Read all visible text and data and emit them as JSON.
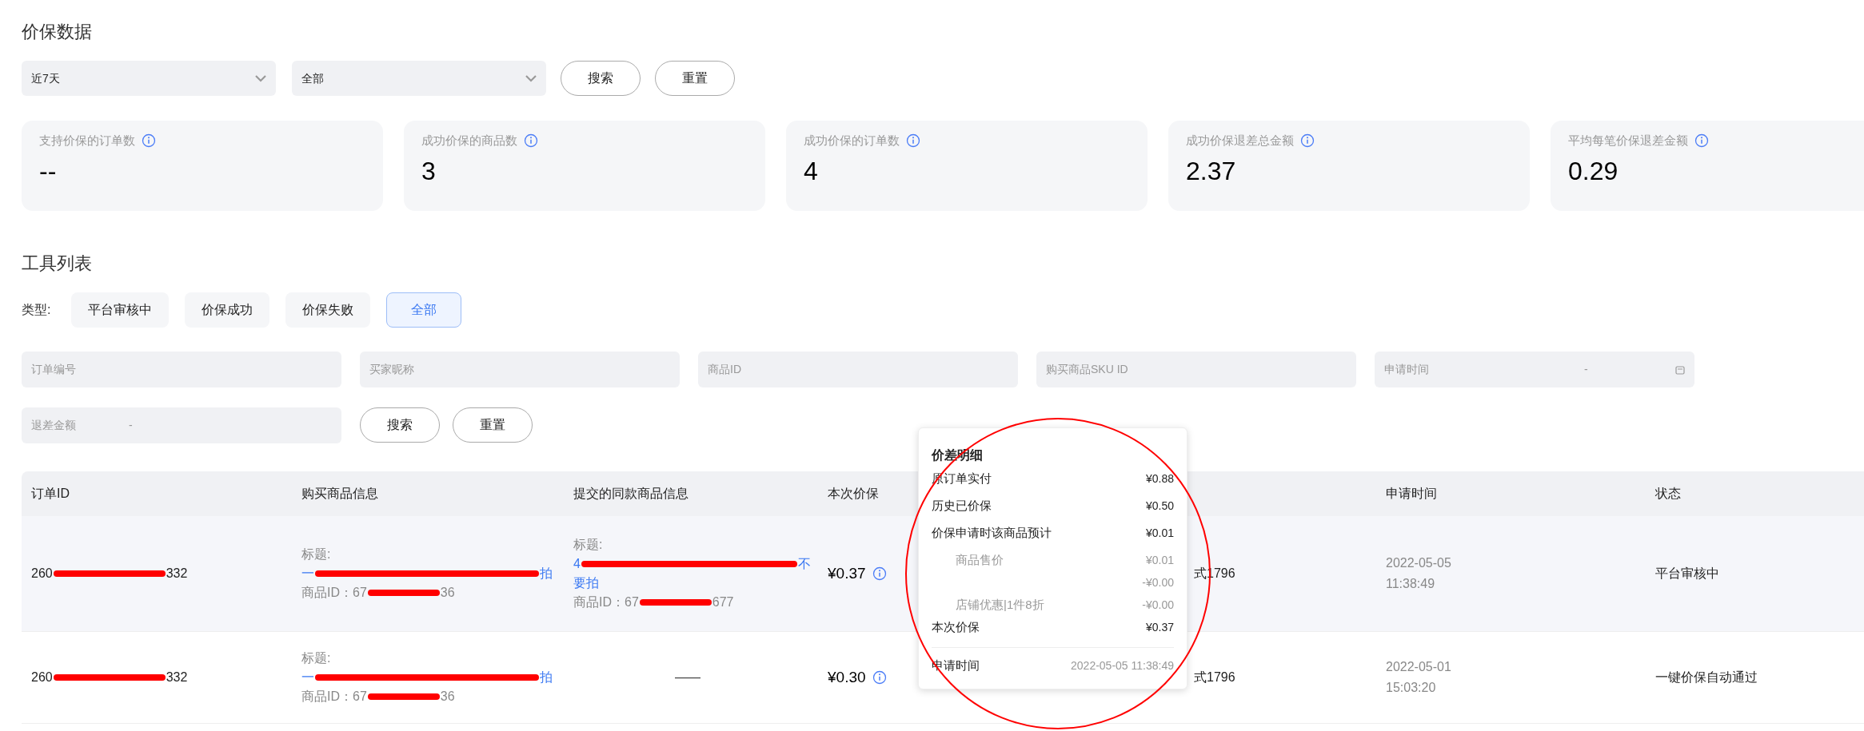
{
  "section_title": "价保数据",
  "filters": [
    {
      "kind": "select",
      "value": "近7天"
    },
    {
      "kind": "select",
      "value": "全部"
    }
  ],
  "filter_buttons": [
    "搜索",
    "重置"
  ],
  "stats": [
    {
      "label": "支持价保的订单数",
      "value": "--"
    },
    {
      "label": "成功价保的商品数",
      "value": "3"
    },
    {
      "label": "成功价保的订单数",
      "value": "4"
    },
    {
      "label": "成功价保退差总金额",
      "value": "2.37"
    },
    {
      "label": "平均每笔价保退差金额",
      "value": "0.29"
    }
  ],
  "list_title": "工具列表",
  "type_label": "类型:",
  "type_tabs": [
    {
      "label": "平台审核中",
      "selected": false
    },
    {
      "label": "价保成功",
      "selected": false
    },
    {
      "label": "价保失败",
      "selected": false
    },
    {
      "label": "全部",
      "selected": true
    }
  ],
  "search_fields": [
    {
      "kind": "text",
      "placeholder": "订单编号"
    },
    {
      "kind": "text",
      "placeholder": "买家昵称"
    },
    {
      "kind": "text",
      "placeholder": "商品ID"
    },
    {
      "kind": "text",
      "placeholder": "购买商品SKU ID"
    },
    {
      "kind": "date_range",
      "placeholder": "申请时间",
      "separator": "-"
    },
    {
      "kind": "range",
      "placeholder": "退差金额",
      "separator": "-"
    }
  ],
  "search_buttons": [
    "搜索",
    "重置"
  ],
  "table": {
    "columns": [
      "订单ID",
      "购买商品信息",
      "提交的同款商品信息",
      "本次价保",
      "",
      "申请时间",
      "状态"
    ],
    "rows": [
      {
        "order_id_start": "260",
        "order_id_end": "332",
        "bought": {
          "label": "标题:",
          "title_start": "一",
          "title_end": "拍",
          "id_start": "商品ID：67",
          "id_end": "36"
        },
        "submitted": {
          "label": "标题:",
          "title_start": "4",
          "title_end": "不",
          "title_line2": "要拍",
          "id_start": "商品ID：67",
          "id_end": "677"
        },
        "amount": "¥0.37",
        "column_5": "式1796",
        "time_date": "2022-05-05",
        "time_clock": "11:38:49",
        "status": "平台审核中"
      },
      {
        "order_id_start": "260",
        "order_id_end": "332",
        "bought": {
          "label": "标题:",
          "title_start": "一",
          "title_end": "拍",
          "id_start": "商品ID：67",
          "id_end": "36"
        },
        "submitted_empty": "——",
        "amount": "¥0.30",
        "column_5": "式1796",
        "time_date": "2022-05-01",
        "time_clock": "15:03:20",
        "status": "一键价保自动通过"
      }
    ]
  },
  "popover": {
    "title": "价差明细",
    "lines": [
      {
        "kind": "main",
        "label": "原订单实付",
        "value": "¥0.88"
      },
      {
        "kind": "main",
        "label": "历史已价保",
        "value": "¥0.50"
      },
      {
        "kind": "main",
        "label": "价保申请时该商品预计",
        "value": "¥0.01"
      },
      {
        "kind": "sub",
        "label": "商品售价",
        "value": "¥0.01"
      },
      {
        "kind": "sub",
        "value": "-¥0.00"
      },
      {
        "kind": "sub",
        "label": "店铺优惠|1件8折",
        "value": "-¥0.00"
      },
      {
        "kind": "main",
        "label": "本次价保",
        "value": "¥0.37"
      },
      {
        "kind": "footer",
        "label": "申请时间",
        "value": "2022-05-05 11:38:49"
      }
    ]
  }
}
